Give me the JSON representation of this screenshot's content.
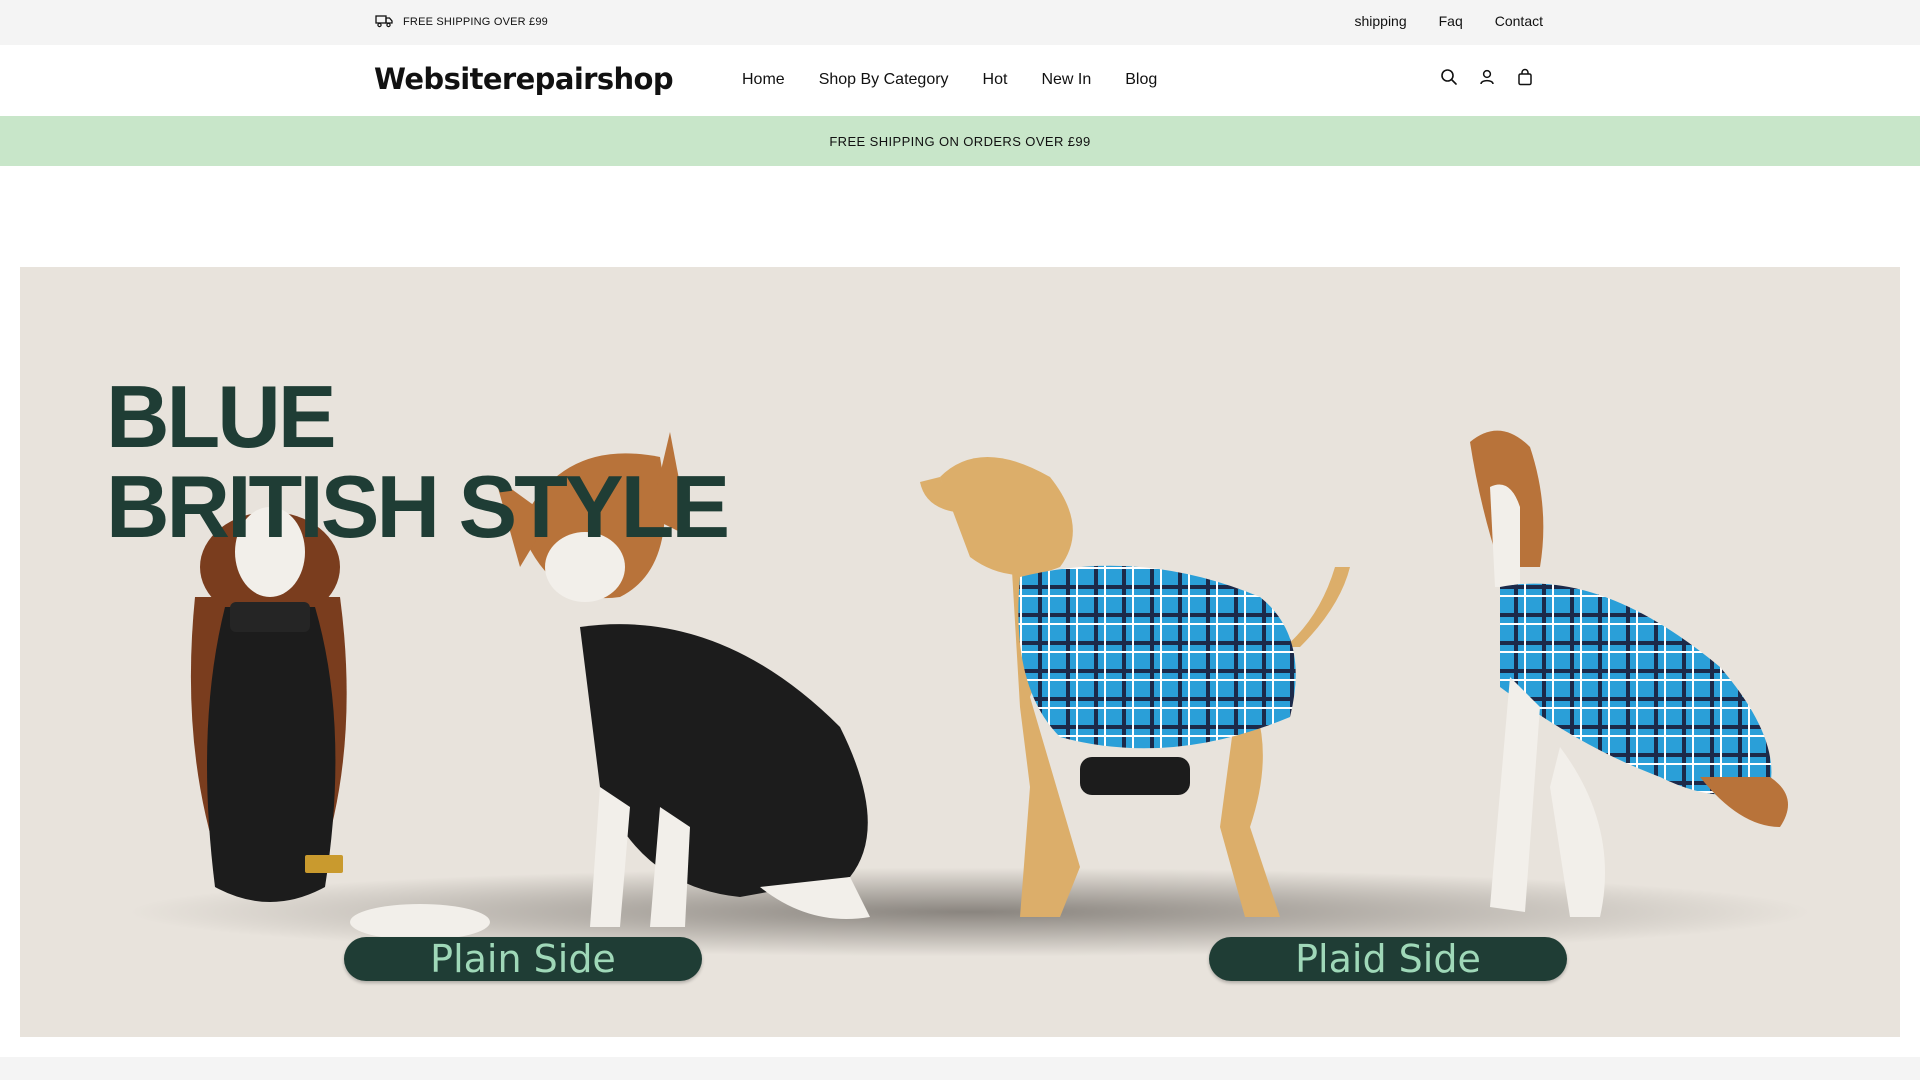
{
  "topbar": {
    "shipping_text": "FREE SHIPPING OVER £99",
    "links": [
      "shipping",
      "Faq",
      "Contact"
    ]
  },
  "header": {
    "logo": "Websiterepairshop",
    "nav": [
      "Home",
      "Shop By Category",
      "Hot",
      "New In",
      "Blog"
    ],
    "icons": [
      "search-icon",
      "account-icon",
      "bag-icon"
    ]
  },
  "announcement": {
    "text": "FREE SHIPPING ON ORDERS OVER £99"
  },
  "hero": {
    "heading_line1": "BLUE",
    "heading_line2": "BRITISH STYLE",
    "left_label": "Plain Side",
    "right_label": "Plaid Side"
  },
  "colors": {
    "announce_bg": "#c8e6c9",
    "hero_bg": "#e8e3dc",
    "brand_green": "#1f3d35",
    "pill_text": "#9fd8b8",
    "plaid_blue": "#2a9fd8",
    "coat_black": "#1c1c1c"
  }
}
